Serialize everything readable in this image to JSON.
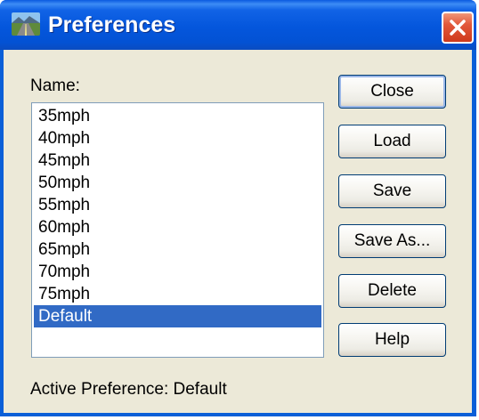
{
  "window": {
    "title": "Preferences"
  },
  "colors": {
    "titlebar": "#0456dc",
    "close_button": "#e2573a",
    "dialog_background": "#ece9d8",
    "selection": "#316ac5"
  },
  "icons": {
    "app": "landscape-road-icon",
    "close": "close-icon"
  },
  "list": {
    "label": "Name:",
    "items": [
      "35mph",
      "40mph",
      "45mph",
      "50mph",
      "55mph",
      "60mph",
      "65mph",
      "70mph",
      "75mph",
      "Default"
    ],
    "selected": "Default"
  },
  "buttons": {
    "close": "Close",
    "load": "Load",
    "save": "Save",
    "save_as": "Save As...",
    "delete": "Delete",
    "help": "Help"
  },
  "status": {
    "active_preference": "Active Preference: Default"
  }
}
